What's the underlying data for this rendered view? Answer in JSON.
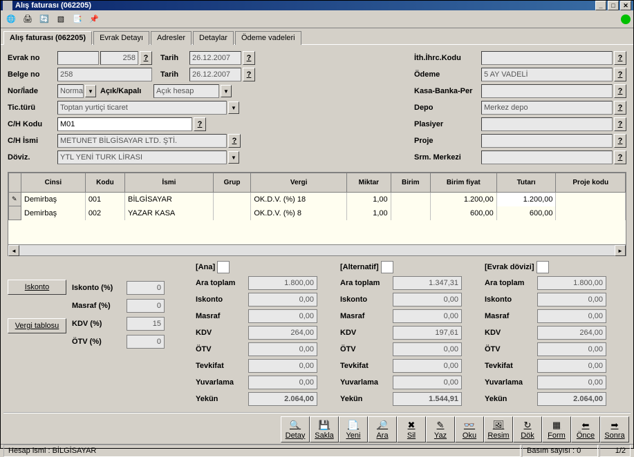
{
  "window": {
    "title": "Alış faturası (062205)"
  },
  "tabs": [
    "Alış faturası (062205)",
    "Evrak Detayı",
    "Adresler",
    "Detaylar",
    "Ödeme vadeleri"
  ],
  "activeTab": 0,
  "leftFields": {
    "evrak_no_lbl": "Evrak no",
    "evrak_no_pre": "",
    "evrak_no": "258",
    "belge_no_lbl": "Belge no",
    "belge_no": "258",
    "nor_iade_lbl": "Nor/İade",
    "nor_iade": "Norma",
    "acik_kapali_lbl": "Açık/Kapalı",
    "acik_kapali": "Açık hesap",
    "tic_turu_lbl": "Tic.türü",
    "tic_turu": "Toptan yurtiçi ticaret",
    "ch_kodu_lbl": "C/H Kodu",
    "ch_kodu": "M01",
    "ch_ismi_lbl": "C/H İsmi",
    "ch_ismi": "METUNET BİLGİSAYAR LTD. ŞTİ.",
    "doviz_lbl": "Döviz.",
    "doviz": "YTL YENİ TURK LİRASI",
    "tarih_lbl": "Tarih",
    "tarih1": "26.12.2007",
    "tarih2": "26.12.2007"
  },
  "rightFields": {
    "ith_lbl": "İth.İhrc.Kodu",
    "ith": "",
    "odeme_lbl": "Ödeme",
    "odeme": "5 AY VADELİ",
    "kasa_lbl": "Kasa-Banka-Per",
    "kasa": "",
    "depo_lbl": "Depo",
    "depo": "Merkez depo",
    "plasiyer_lbl": "Plasiyer",
    "plasiyer": "",
    "proje_lbl": "Proje",
    "proje": "",
    "srm_lbl": "Srm. Merkezi",
    "srm": ""
  },
  "grid": {
    "headers": [
      "Cinsi",
      "Kodu",
      "İsmi",
      "Grup",
      "Vergi",
      "Miktar",
      "Birim",
      "Birim fiyat",
      "Tutarı",
      "Proje kodu"
    ],
    "rows": [
      {
        "cinsi": "Demirbaş",
        "kodu": "001",
        "ismi": "BİLGİSAYAR",
        "grup": "",
        "vergi": "OK.D.V. (%) 18",
        "miktar": "1,00",
        "birim": "",
        "birim_fiyat": "1.200,00",
        "tutari": "1.200,00",
        "proje": ""
      },
      {
        "cinsi": "Demirbaş",
        "kodu": "002",
        "ismi": "YAZAR KASA",
        "grup": "",
        "vergi": "OK.D.V. (%) 8",
        "miktar": "1,00",
        "birim": "",
        "birim_fiyat": "600,00",
        "tutari": "600,00",
        "proje": ""
      }
    ]
  },
  "leftTotals": {
    "iskonto_btn": "Iskonto",
    "vergi_btn": "Vergi tablosu",
    "iskonto_lbl": "Iskonto (%)",
    "iskonto": "0",
    "masraf_lbl": "Masraf  (%)",
    "masraf": "0",
    "kdv_lbl": "KDV    (%)",
    "kdv": "15",
    "otv_lbl": "ÖTV    (%)",
    "otv": "0"
  },
  "totalLabels": {
    "ara": "Ara toplam",
    "iskonto": "Iskonto",
    "masraf": "Masraf",
    "kdv": "KDV",
    "otv": "ÖTV",
    "tevkifat": "Tevkifat",
    "yuvarlama": "Yuvarlama",
    "yekun": "Yekün"
  },
  "totalsAna": {
    "hdr": "[Ana]",
    "ara": "1.800,00",
    "iskonto": "0,00",
    "masraf": "0,00",
    "kdv": "264,00",
    "otv": "0,00",
    "tevkifat": "0,00",
    "yuvarlama": "0,00",
    "yekun": "2.064,00"
  },
  "totalsAlt": {
    "hdr": "[Alternatif]",
    "ara": "1.347,31",
    "iskonto": "0,00",
    "masraf": "0,00",
    "kdv": "197,61",
    "otv": "0,00",
    "tevkifat": "0,00",
    "yuvarlama": "0,00",
    "yekun": "1.544,91"
  },
  "totalsEvr": {
    "hdr": "[Evrak dövizi]",
    "ara": "1.800,00",
    "iskonto": "0,00",
    "masraf": "0,00",
    "kdv": "264,00",
    "otv": "0,00",
    "tevkifat": "0,00",
    "yuvarlama": "0,00",
    "yekun": "2.064,00"
  },
  "bottomButtons": [
    {
      "id": "detay",
      "label": "Detay",
      "icon": "🔍"
    },
    {
      "id": "sakla",
      "label": "Sakla",
      "icon": "💾"
    },
    {
      "id": "yeni",
      "label": "Yeni",
      "icon": "📄"
    },
    {
      "id": "ara",
      "label": "Ara",
      "icon": "🔎"
    },
    {
      "id": "sil",
      "label": "Sil",
      "icon": "✖"
    },
    {
      "id": "yaz",
      "label": "Yaz",
      "icon": "✎"
    },
    {
      "id": "oku",
      "label": "Oku",
      "icon": "👓"
    },
    {
      "id": "resim",
      "label": "Resim",
      "icon": "🖼"
    },
    {
      "id": "dok",
      "label": "Dök",
      "icon": "↻"
    },
    {
      "id": "form",
      "label": "Form",
      "icon": "▦"
    },
    {
      "id": "once",
      "label": "Önce",
      "icon": "⬅"
    },
    {
      "id": "sonra",
      "label": "Sonra",
      "icon": "➡"
    }
  ],
  "statusbar": {
    "hesap": "Hesap ismi : BİLGİSAYAR",
    "basim": "Basım sayısı : 0",
    "page": "1/2"
  }
}
